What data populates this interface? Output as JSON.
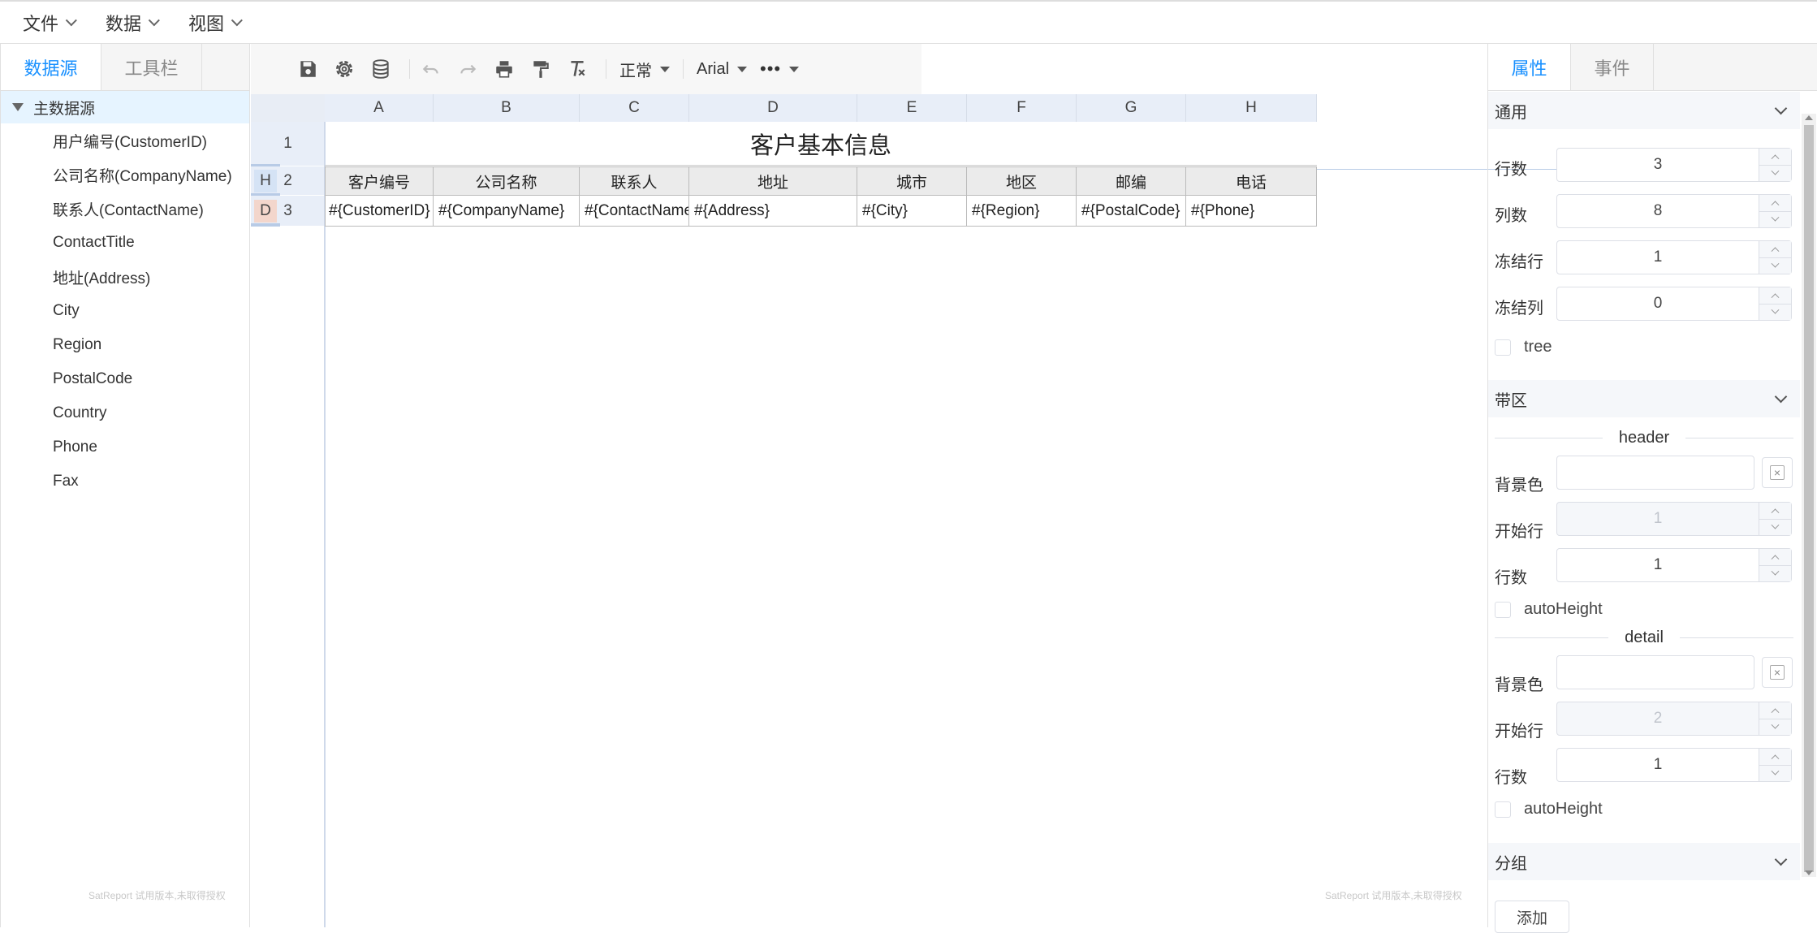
{
  "menu": [
    "文件",
    "数据",
    "视图"
  ],
  "left_tabs": [
    "数据源",
    "工具栏"
  ],
  "tree": {
    "root": "主数据源",
    "items": [
      "用户编号(CustomerID)",
      "公司名称(CompanyName)",
      "联系人(ContactName)",
      "ContactTitle",
      "地址(Address)",
      "City",
      "Region",
      "PostalCode",
      "Country",
      "Phone",
      "Fax"
    ]
  },
  "watermark": "SatReport 试用版本,未取得授权",
  "toolbar": {
    "style_value": "正常",
    "font_value": "Arial"
  },
  "sheet": {
    "columns": [
      "A",
      "B",
      "C",
      "D",
      "E",
      "F",
      "G",
      "H"
    ],
    "rows": [
      "1",
      "2",
      "3"
    ],
    "band_header": "H",
    "band_detail": "D",
    "title": "客户基本信息",
    "header_cells": [
      "客户编号",
      "公司名称",
      "联系人",
      "地址",
      "城市",
      "地区",
      "邮编",
      "电话"
    ],
    "detail_cells": [
      "#{CustomerID}",
      "#{CompanyName}",
      "#{ContactName}",
      "#{Address}",
      "#{City}",
      "#{Region}",
      "#{PostalCode}",
      "#{Phone}"
    ]
  },
  "right_tabs": [
    "属性",
    "事件"
  ],
  "props": {
    "general_title": "通用",
    "rows_label": "行数",
    "rows_value": "3",
    "cols_label": "列数",
    "cols_value": "8",
    "freeze_rows_label": "冻结行",
    "freeze_rows_value": "1",
    "freeze_cols_label": "冻结列",
    "freeze_cols_value": "0",
    "tree_label": "tree",
    "band_title": "带区",
    "header_title": "header",
    "bg_label": "背景色",
    "start_row_label": "开始行",
    "header_start_value": "1",
    "header_rows_value": "1",
    "autoheight_label": "autoHeight",
    "detail_title": "detail",
    "detail_start_value": "2",
    "detail_rows_value": "1",
    "group_title": "分组",
    "add_label": "添加"
  },
  "colors": {
    "accent": "#1890ff",
    "header_bg": "#e8eef8",
    "band_h": "#d5e3f5",
    "band_d": "#f3d6cc"
  }
}
